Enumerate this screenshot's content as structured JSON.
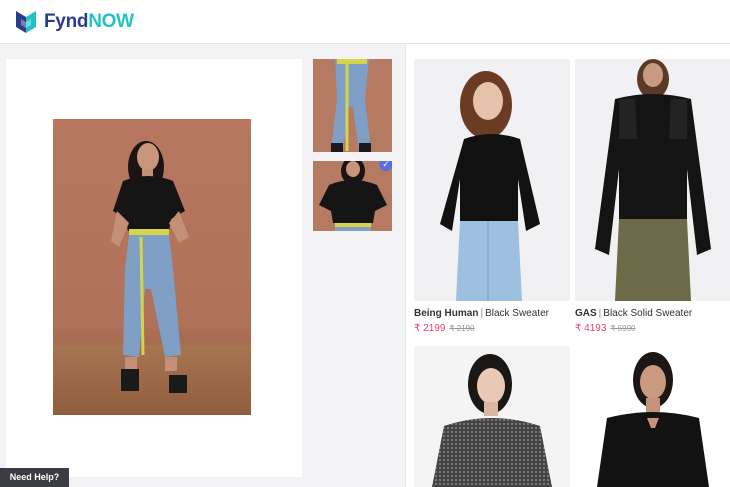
{
  "header": {
    "logo_main": "Fynd",
    "logo_accent": "NOW",
    "brand_colors": {
      "primary": "#2d3b8c",
      "accent": "#22c3c5"
    }
  },
  "left_panel": {
    "main_image_icon": "fashion-photo",
    "thumbnails": [
      {
        "icon": "thumbnail-photo",
        "selected": false
      },
      {
        "icon": "thumbnail-photo",
        "selected": true
      }
    ]
  },
  "results": [
    {
      "brand": "Being Human",
      "name": "Black Sweater",
      "price": "₹ 2199",
      "mrp": "₹ 2190"
    },
    {
      "brand": "GAS",
      "name": "Black Solid Sweater",
      "price": "₹ 4193",
      "mrp": "₹ 5990"
    },
    {
      "brand": "",
      "name": "",
      "price": "",
      "mrp": ""
    },
    {
      "brand": "",
      "name": "",
      "price": "",
      "mrp": ""
    }
  ],
  "help": {
    "label": "Need Help?"
  },
  "colors": {
    "price": "#e8436d",
    "check": "#5b6fdc"
  }
}
